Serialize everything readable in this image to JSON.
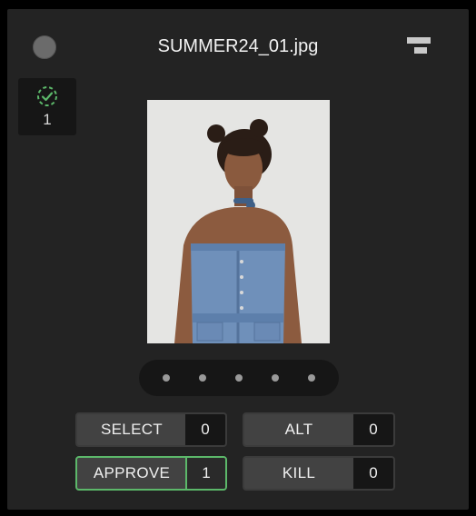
{
  "header": {
    "filename": "SUMMER24_01.jpg",
    "status_icon": "circle-status-icon",
    "menu_icon": "stack-menu-icon"
  },
  "badge": {
    "icon": "dashed-check-circle-icon",
    "count": "1",
    "accent": "#5cb86a"
  },
  "photo": {
    "description_icon": "product-photo"
  },
  "pager": {
    "dot_count": 5
  },
  "votes": {
    "select": {
      "label": "SELECT",
      "count": "0"
    },
    "alt": {
      "label": "ALT",
      "count": "0"
    },
    "approve": {
      "label": "APPROVE",
      "count": "1",
      "active": true
    },
    "kill": {
      "label": "KILL",
      "count": "0"
    }
  },
  "colors": {
    "panel": "#232323",
    "button": "#424242",
    "count_bg": "#161616",
    "approve_accent": "#5cb86a"
  }
}
